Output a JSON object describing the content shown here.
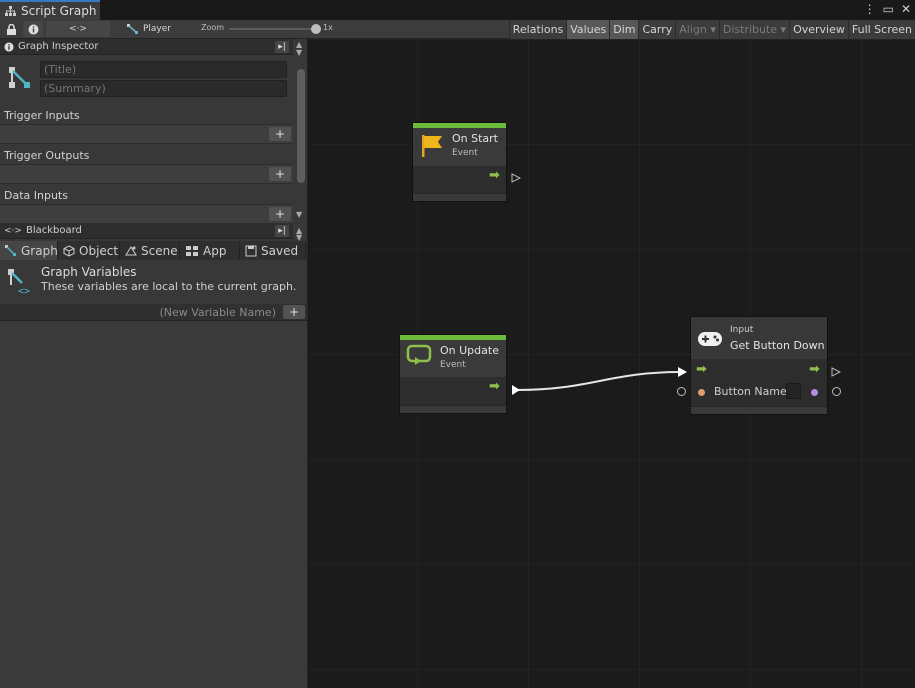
{
  "window": {
    "title": "Script Graph",
    "icons": [
      "more-vert-icon",
      "maximize-icon",
      "close-icon"
    ]
  },
  "toolbar": {
    "lock_icon": "lock-icon",
    "info_icon": "info-icon",
    "graph_btn": "<·>",
    "player_label": "Player",
    "zoom_label": "Zoom",
    "zoom_value": "1x",
    "zoom_level": 1.0,
    "right_buttons": [
      {
        "label": "Relations",
        "state": "normal"
      },
      {
        "label": "Values",
        "state": "on"
      },
      {
        "label": "Dim",
        "state": "on"
      },
      {
        "label": "Carry",
        "state": "normal"
      },
      {
        "label": "Align ▾",
        "state": "disabled"
      },
      {
        "label": "Distribute ▾",
        "state": "disabled"
      },
      {
        "label": "Overview",
        "state": "normal"
      },
      {
        "label": "Full Screen",
        "state": "normal"
      }
    ]
  },
  "inspector": {
    "header": "Graph Inspector",
    "title_placeholder": "(Title)",
    "summary_placeholder": "(Summary)",
    "sections": [
      {
        "label": "Trigger Inputs"
      },
      {
        "label": "Trigger Outputs"
      },
      {
        "label": "Data Inputs"
      }
    ],
    "plus": "+"
  },
  "blackboard": {
    "header": "Blackboard",
    "tabs": [
      {
        "label": "Graph",
        "icon": "graph-icon",
        "active": true
      },
      {
        "label": "Object",
        "icon": "cube-icon",
        "active": false
      },
      {
        "label": "Scene",
        "icon": "scene-icon",
        "active": false
      },
      {
        "label": "App",
        "icon": "app-icon",
        "active": false
      },
      {
        "label": "Saved",
        "icon": "save-icon",
        "active": false
      }
    ],
    "vars_title": "Graph Variables",
    "vars_desc": "These variables are local to the current graph.",
    "new_var_placeholder": "(New Variable Name)",
    "plus": "+"
  },
  "nodes": {
    "on_start": {
      "title": "On Start",
      "subtitle": "Event",
      "icon": "flag-icon",
      "color": "#6dbb3a"
    },
    "on_update": {
      "title": "On Update",
      "subtitle": "Event",
      "icon": "loop-icon",
      "color": "#6dbb3a"
    },
    "get_button": {
      "category": "Input",
      "title": "Get Button Down",
      "icon": "gamepad-icon",
      "port_label": "Button Name"
    }
  },
  "colors": {
    "accent": "#3a79bb",
    "event_green": "#6dbb3a",
    "flow_arrow": "#8ec04a",
    "string_port": "#e39b6d",
    "bool_port": "#b68ee0"
  }
}
